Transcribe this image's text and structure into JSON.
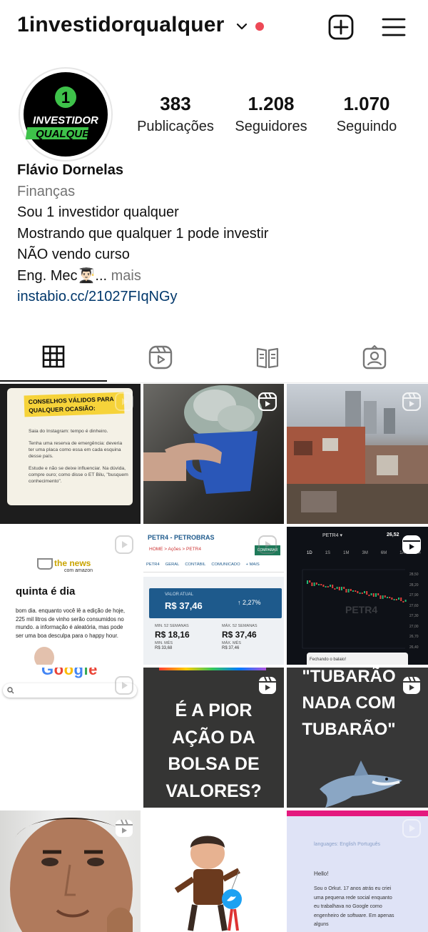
{
  "header": {
    "username": "1investidorqualquer",
    "icons": [
      "chevron-down-icon",
      "notification-dot",
      "new-post-icon",
      "menu-icon"
    ]
  },
  "profile": {
    "avatar": {
      "line1": "INVESTIDOR",
      "line2": "QUALQUER",
      "badge": "1"
    },
    "stats": [
      {
        "value": "383",
        "label": "Publicações"
      },
      {
        "value": "1.208",
        "label": "Seguidores"
      },
      {
        "value": "1.070",
        "label": "Seguindo"
      }
    ],
    "name": "Flávio Dornelas",
    "category": "Finanças",
    "bio_lines": [
      "Sou 1 investidor qualquer",
      "Mostrando que qualquer 1 pode investir",
      "NÃO vendo curso"
    ],
    "bio_last": "Eng. Mec👨🏻‍🎓...",
    "more": " mais",
    "link": "instabio.cc/21027FIqNGy"
  },
  "tabs": [
    "grid-tab",
    "reels-tab",
    "guides-tab",
    "tagged-tab"
  ],
  "posts": {
    "p1": {
      "title": "CONSELHOS VÁLIDOS PARA QUALQUER OCASIÃO:",
      "items": [
        "Saia do Instagram: tempo é dinheiro.",
        "Tenha uma reserva de emergência: deveria ter uma placa como essa em cada esquina desse país.",
        "Estude e não se deixe influenciar. Na dúvida, compre ouro; como disse o ET Bilu, \"busquem conhecimento\"."
      ]
    },
    "p4": {
      "brand": "the news",
      "sub": "com amazon",
      "heading": "quinta é dia",
      "body": "bom dia. enquanto você lê a edição de hoje, 225 mil litros de vinho serão consumidos no mundo. a informação é aleatória, mas pode ser uma boa desculpa para o happy hour."
    },
    "p5": {
      "ticker": "PETR4 - PETROBRAS",
      "crumbs": "HOME > Ações > PETR4",
      "compare": "COMPARAR",
      "tabs": [
        "PETR4",
        "GERAL",
        "CONTÁBIL",
        "COMUNICADO",
        "+ MAIS"
      ],
      "price_label": "VALOR ATUAL",
      "price": "R$ 37,46",
      "change": "↑ 2,27%",
      "min_label": "MIN. 52 SEMANAS",
      "min": "R$ 18,16",
      "min_sub": "MIN. MÊS",
      "min_sub_val": "R$ 33,68",
      "max_label": "MÁX. 52 SEMANAS",
      "max": "R$ 37,46",
      "max_sub": "MÁX. MÊS",
      "max_sub_val": "R$ 37,46"
    },
    "p6": {
      "ticker": "PETR4 ▾",
      "price": "26,52",
      "periods": [
        "1D",
        "1S",
        "1M",
        "3M",
        "6M",
        "1A",
        "∞"
      ],
      "watermark": "PETR4",
      "toast": "Fechando o balaio!",
      "axis": [
        "28,50",
        "28,20",
        "27,90",
        "27,60",
        "27,30",
        "27,00",
        "26,70",
        "26,40"
      ]
    },
    "p7": {
      "google": "Google"
    },
    "p8": {
      "text": "É A PIOR AÇÃO DA BOLSA DE VALORES?"
    },
    "p9": {
      "text": "\"TUBARÃO NADA COM TUBARÃO\""
    },
    "p12": {
      "languages": "languages: English Português",
      "hello": "Hello!",
      "body": "Sou o Orkut. 17 anos atrás eu criei uma pequena rede social enquanto eu trabalhava no Google como engenheiro de software. Em apenas alguns"
    }
  },
  "colors": {
    "notification": "#ed4956",
    "link": "#00376b",
    "muted": "#737373",
    "petr_green": "#1f7a5a",
    "petr_blue": "#1e5a8c",
    "yellow_tag": "#f6d33a"
  }
}
